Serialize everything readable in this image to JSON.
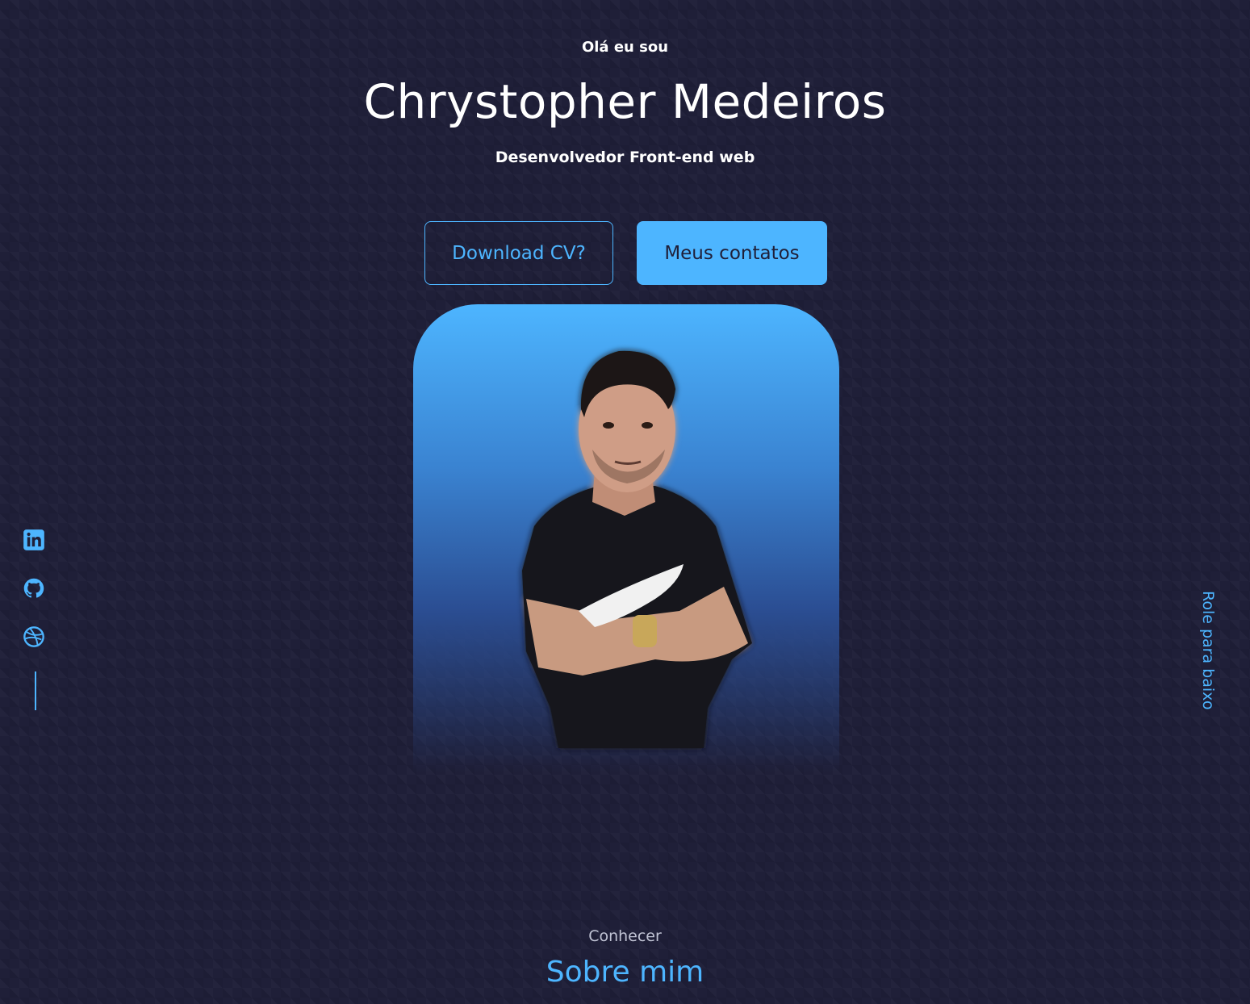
{
  "header": {
    "greeting": "Olá eu sou",
    "name": "Chrystopher Medeiros",
    "role": "Desenvolvedor Front-end web"
  },
  "cta": {
    "download_label": "Download CV?",
    "contacts_label": "Meus contatos"
  },
  "socials": {
    "items": [
      {
        "icon": "linkedin-icon"
      },
      {
        "icon": "github-icon"
      },
      {
        "icon": "dribbble-icon"
      }
    ]
  },
  "scroll": {
    "label": "Role para baixo"
  },
  "about": {
    "subtitle": "Conhecer",
    "title": "Sobre mim"
  },
  "colors": {
    "background": "#1f1f38",
    "accent": "#4db5ff",
    "text": "#ffffff"
  }
}
